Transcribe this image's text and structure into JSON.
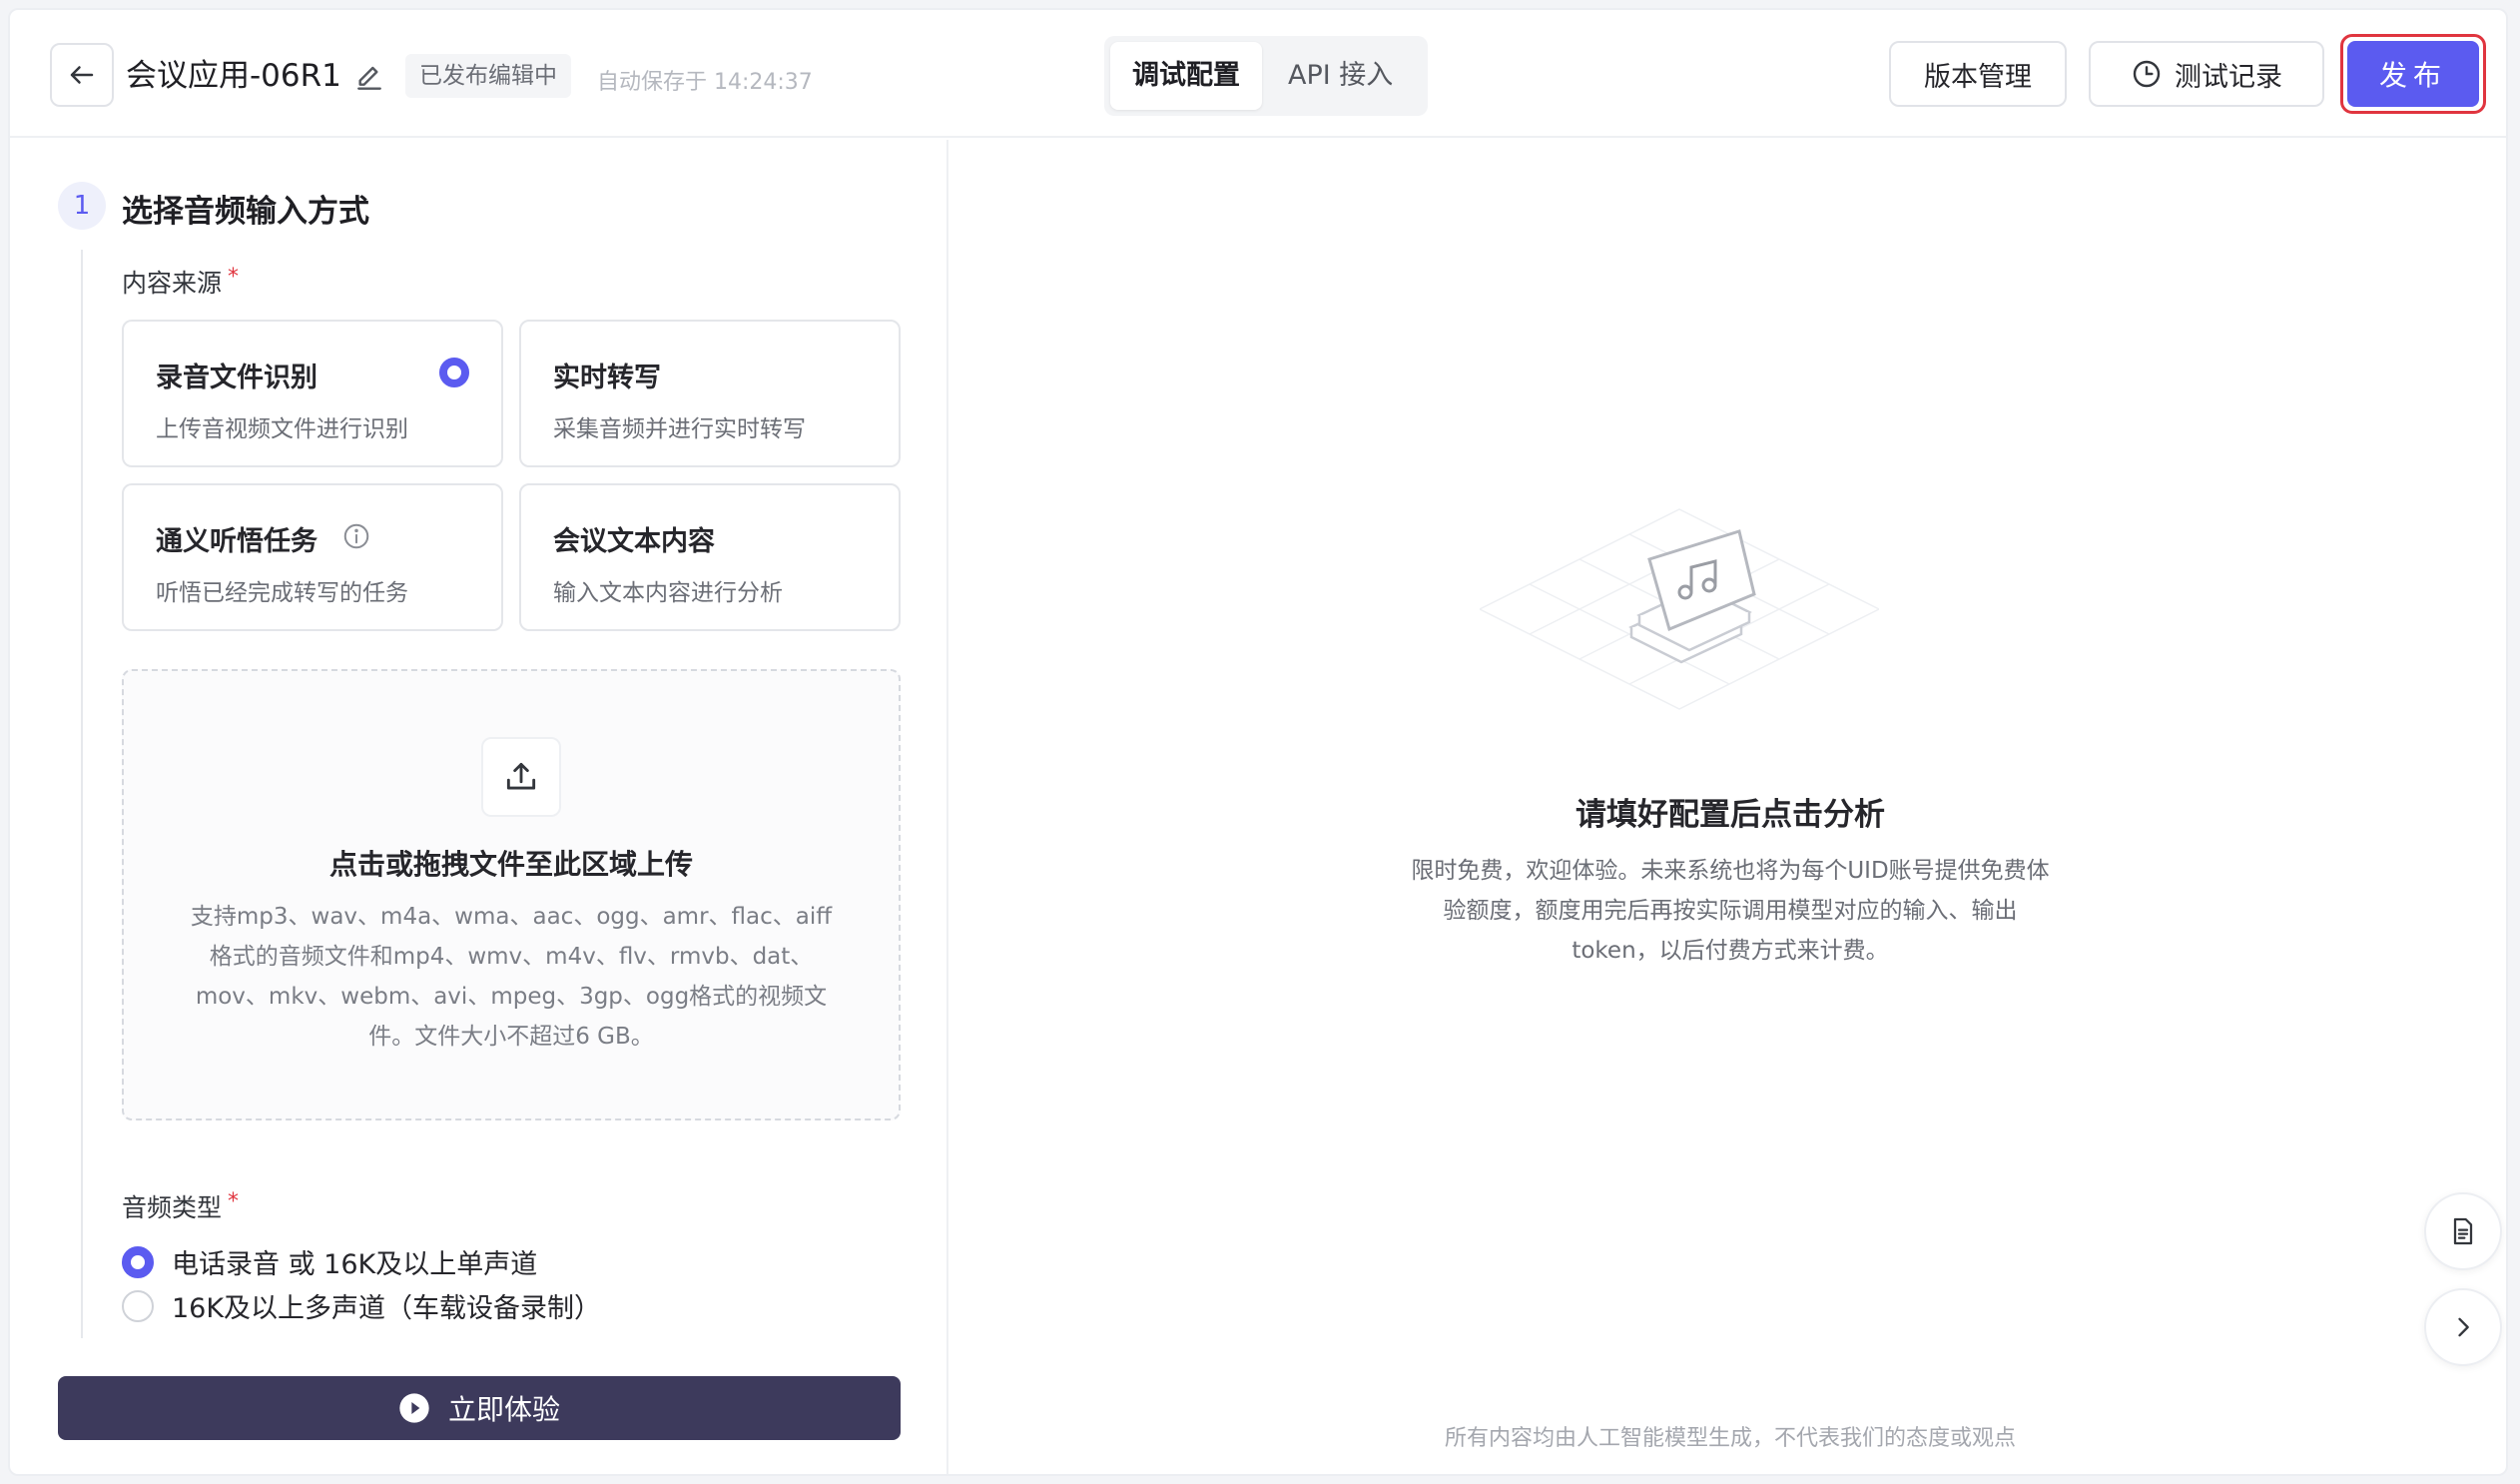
{
  "header": {
    "back_icon": "arrow-left-icon",
    "app_title": "会议应用-06R1",
    "edit_icon": "pencil-icon",
    "status_tag": "已发布编辑中",
    "autosave_text": "自动保存于 14:24:37",
    "tabs": [
      {
        "label": "调试配置",
        "active": true
      },
      {
        "label": "API 接入",
        "active": false
      }
    ],
    "versions_label": "版本管理",
    "records_label": "测试记录",
    "records_icon": "clock-icon",
    "publish_label": "发布"
  },
  "config": {
    "step_number": "1",
    "step_title": "选择音频输入方式",
    "source_label": "内容来源",
    "required_mark": "*",
    "source_options": [
      {
        "title": "录音文件识别",
        "desc": "上传音视频文件进行识别",
        "selected": true
      },
      {
        "title": "实时转写",
        "desc": "采集音频并进行实时转写",
        "selected": false
      },
      {
        "title": "通义听悟任务",
        "desc": "听悟已经完成转写的任务",
        "selected": false
      },
      {
        "title": "会议文本内容",
        "desc": "输入文本内容进行分析",
        "selected": false
      }
    ],
    "upload": {
      "icon": "upload-icon",
      "title": "点击或拖拽文件至此区域上传",
      "desc": "支持mp3、wav、m4a、wma、aac、ogg、amr、flac、aiff格式的音频文件和mp4、wmv、m4v、flv、rmvb、dat、mov、mkv、webm、avi、mpeg、3gp、ogg格式的视频文件。文件大小不超过6 GB。"
    },
    "audio_type_label": "音频类型",
    "audio_types": [
      {
        "label": "电话录音 或 16K及以上单声道",
        "selected": true
      },
      {
        "label": "16K及以上多声道（车载设备录制）",
        "selected": false
      }
    ],
    "try_label": "立即体验",
    "try_icon": "play-circle-icon"
  },
  "result": {
    "empty_icon": "music-file-stack-icon",
    "empty_title": "请填好配置后点击分析",
    "empty_desc": "限时免费，欢迎体验。未来系统也将为每个UID账号提供免费体验额度，额度用完后再按实际调用模型对应的输入、输出token，以后付费方式来计费。",
    "disclaimer": "所有内容均由人工智能模型生成，不代表我们的态度或观点",
    "doc_icon": "document-icon",
    "expand_icon": "chevron-right-icon"
  },
  "colors": {
    "accent": "#5b5bf0",
    "publish_outline": "#e0353f",
    "try_button": "#3d3a5c"
  }
}
